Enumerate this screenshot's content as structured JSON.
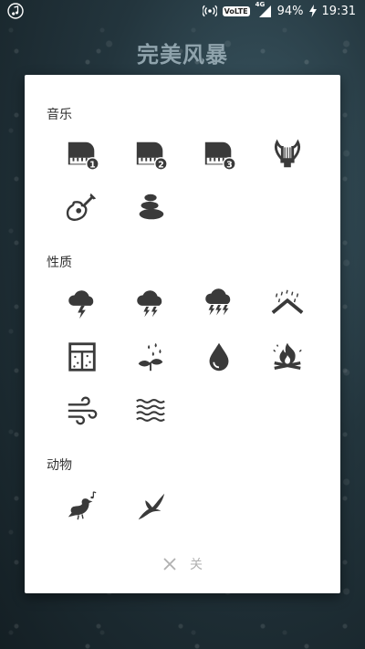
{
  "status_bar": {
    "network_type": "4G",
    "volte_label": "VoLTE",
    "battery": "94%",
    "time": "19:31"
  },
  "app": {
    "title": "完美风暴"
  },
  "dialog": {
    "sections": [
      {
        "title": "音乐",
        "items": [
          "piano-1-icon",
          "piano-2-icon",
          "piano-3-icon",
          "lyre-icon",
          "guitar-icon",
          "zen-stones-icon"
        ]
      },
      {
        "title": "性质",
        "items": [
          "thunderstorm-icon",
          "heavy-thunderstorm-icon",
          "severe-thunderstorm-icon",
          "rain-on-roof-icon",
          "rain-on-window-icon",
          "rain-on-leaves-icon",
          "water-drop-icon",
          "campfire-icon",
          "wind-icon",
          "waves-icon"
        ]
      },
      {
        "title": "动物",
        "items": [
          "songbird-icon",
          "seagull-icon"
        ]
      }
    ],
    "piano_badges": [
      "1",
      "2",
      "3"
    ],
    "close_label": "关"
  },
  "colors": {
    "icon": "#3a3a3a",
    "close": "#b0b0b0"
  }
}
